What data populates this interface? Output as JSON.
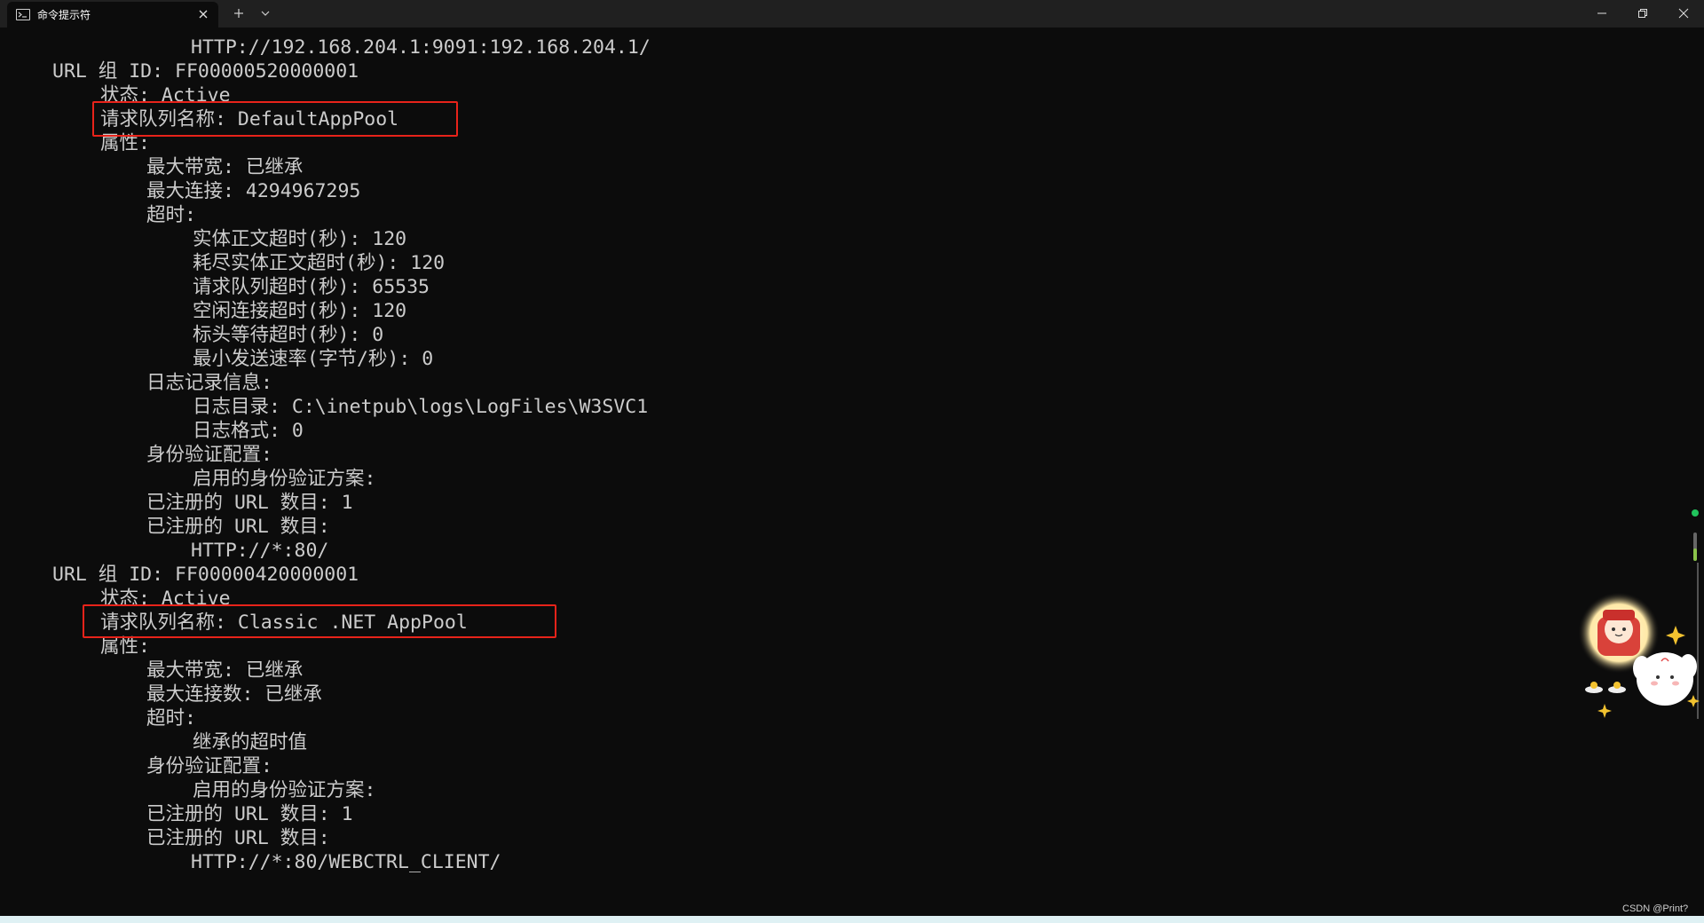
{
  "window": {
    "tab_title": "命令提示符",
    "tab_icon": "terminal-icon",
    "new_tab_icon": "plus-icon",
    "dropdown_icon": "chevron-down-icon",
    "minimize_icon": "minimize-icon",
    "maximize_icon": "restore-icon",
    "close_icon": "close-icon"
  },
  "terminal": {
    "lines": [
      {
        "indent": 0,
        "text": "HTTP://192.168.204.1:9091:192.168.204.1/"
      },
      {
        "indent": 0,
        "text": "URL 组 ID: FF00000520000001"
      },
      {
        "indent": 0,
        "text": "状态: Active"
      },
      {
        "indent": 0,
        "text": "请求队列名称: DefaultAppPool"
      },
      {
        "indent": 0,
        "text": "属性:"
      },
      {
        "indent": 0,
        "text": "最大带宽: 已继承"
      },
      {
        "indent": 0,
        "text": "最大连接: 4294967295"
      },
      {
        "indent": 0,
        "text": "超时:"
      },
      {
        "indent": 0,
        "text": "实体正文超时(秒): 120"
      },
      {
        "indent": 0,
        "text": "耗尽实体正文超时(秒): 120"
      },
      {
        "indent": 0,
        "text": "请求队列超时(秒): 65535"
      },
      {
        "indent": 0,
        "text": "空闲连接超时(秒): 120"
      },
      {
        "indent": 0,
        "text": "标头等待超时(秒): 0"
      },
      {
        "indent": 0,
        "text": "最小发送速率(字节/秒): 0"
      },
      {
        "indent": 0,
        "text": "日志记录信息:"
      },
      {
        "indent": 0,
        "text": "日志目录: C:\\inetpub\\logs\\LogFiles\\W3SVC1"
      },
      {
        "indent": 0,
        "text": "日志格式: 0"
      },
      {
        "indent": 0,
        "text": "身份验证配置:"
      },
      {
        "indent": 0,
        "text": "启用的身份验证方案:"
      },
      {
        "indent": 0,
        "text": "已注册的 URL 数目: 1"
      },
      {
        "indent": 0,
        "text": "已注册的 URL 数目:"
      },
      {
        "indent": 0,
        "text": "HTTP://*:80/"
      },
      {
        "indent": 0,
        "text": "URL 组 ID: FF00000420000001"
      },
      {
        "indent": 0,
        "text": "状态: Active"
      },
      {
        "indent": 0,
        "text": "请求队列名称: Classic .NET AppPool"
      },
      {
        "indent": 0,
        "text": "属性:"
      },
      {
        "indent": 0,
        "text": "最大带宽: 已继承"
      },
      {
        "indent": 0,
        "text": "最大连接数: 已继承"
      },
      {
        "indent": 0,
        "text": "超时:"
      },
      {
        "indent": 0,
        "text": "继承的超时值"
      },
      {
        "indent": 0,
        "text": "身份验证配置:"
      },
      {
        "indent": 0,
        "text": "启用的身份验证方案:"
      },
      {
        "indent": 0,
        "text": "已注册的 URL 数目: 1"
      },
      {
        "indent": 0,
        "text": "已注册的 URL 数目:"
      },
      {
        "indent": 0,
        "text": "HTTP://*:80/WEBCTRL_CLIENT/"
      }
    ]
  },
  "watermark": "CSDN @Print?",
  "colors": {
    "background": "#0c0c0c",
    "titlebar": "#202020",
    "text": "#cccccc",
    "highlight": "#e8231a"
  }
}
